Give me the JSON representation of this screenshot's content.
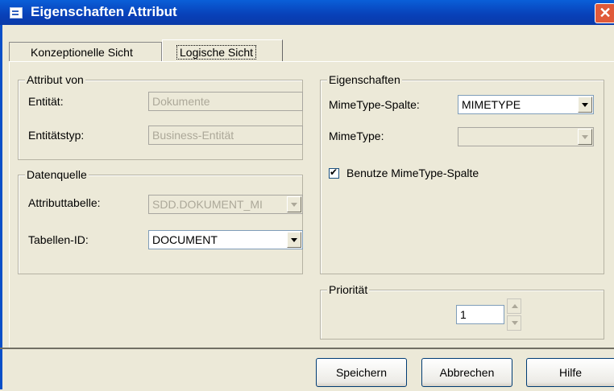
{
  "window": {
    "title": "Eigenschaften Attribut",
    "close_glyph": "✕"
  },
  "tabs": [
    {
      "label": "Konzeptionelle Sicht"
    },
    {
      "label": "Logische Sicht"
    }
  ],
  "attribut_von": {
    "legend": "Attribut von",
    "entitaet_label": "Entität:",
    "entitaet_value": "Dokumente",
    "entitaetstyp_label": "Entitätstyp:",
    "entitaetstyp_value": "Business-Entität"
  },
  "datenquelle": {
    "legend": "Datenquelle",
    "attributtabelle_label": "Attributtabelle:",
    "attributtabelle_value": "SDD.DOKUMENT_MI",
    "tabellen_id_label": "Tabellen-ID:",
    "tabellen_id_value": "DOCUMENT"
  },
  "eigenschaften": {
    "legend": "Eigenschaften",
    "mimetype_spalte_label": "MimeType-Spalte:",
    "mimetype_spalte_value": "MIMETYPE",
    "mimetype_label": "MimeType:",
    "mimetype_value": "",
    "checkbox_label": "Benutze MimeType-Spalte",
    "checkbox_checked": true
  },
  "prioritaet": {
    "legend": "Priorität",
    "value": "1"
  },
  "buttons": {
    "save": "Speichern",
    "cancel": "Abbrechen",
    "help": "Hilfe"
  }
}
